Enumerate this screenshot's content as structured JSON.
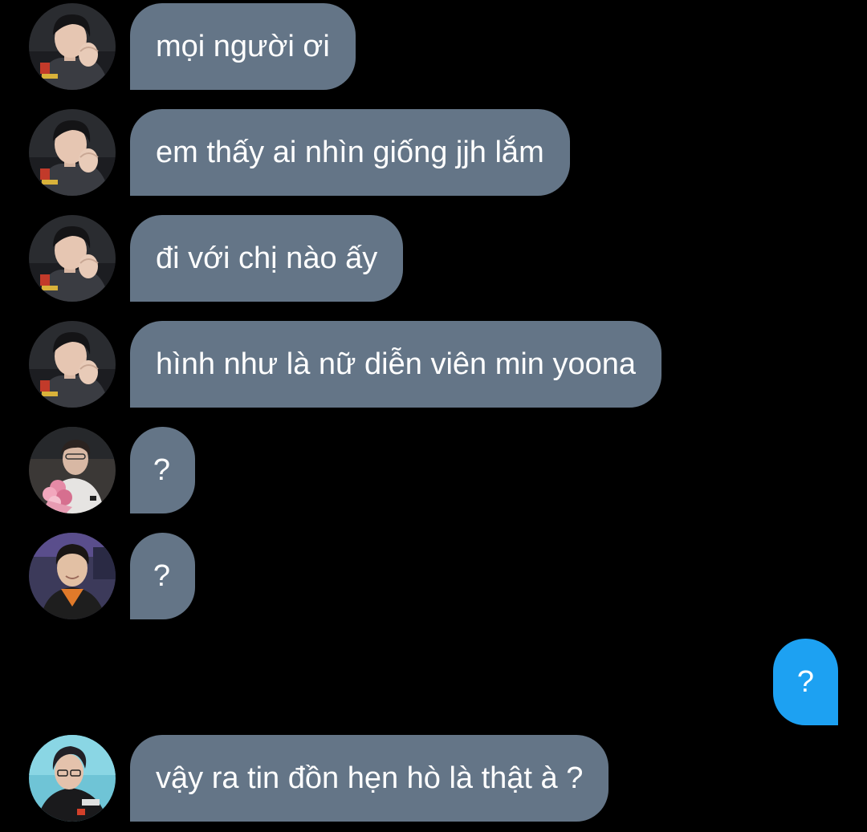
{
  "conversation": {
    "messages": [
      {
        "sender": "incoming",
        "avatar": "avatar-user-a",
        "text": "mọi người ơi"
      },
      {
        "sender": "incoming",
        "avatar": "avatar-user-a",
        "text": "em thấy ai nhìn giống jjh lắm"
      },
      {
        "sender": "incoming",
        "avatar": "avatar-user-a",
        "text": "đi với chị nào ấy"
      },
      {
        "sender": "incoming",
        "avatar": "avatar-user-a",
        "text": "hình như là nữ diễn viên min yoona"
      },
      {
        "sender": "incoming",
        "avatar": "avatar-user-b",
        "text": "?"
      },
      {
        "sender": "incoming",
        "avatar": "avatar-user-c",
        "text": "?"
      },
      {
        "sender": "outgoing",
        "text": "?"
      },
      {
        "sender": "incoming",
        "avatar": "avatar-user-d",
        "text": "vậy ra tin đồn hẹn hò là thật à ?"
      }
    ]
  },
  "colors": {
    "background": "#000000",
    "incoming_bubble": "#647587",
    "outgoing_bubble": "#1da1f2",
    "text": "#ffffff"
  }
}
